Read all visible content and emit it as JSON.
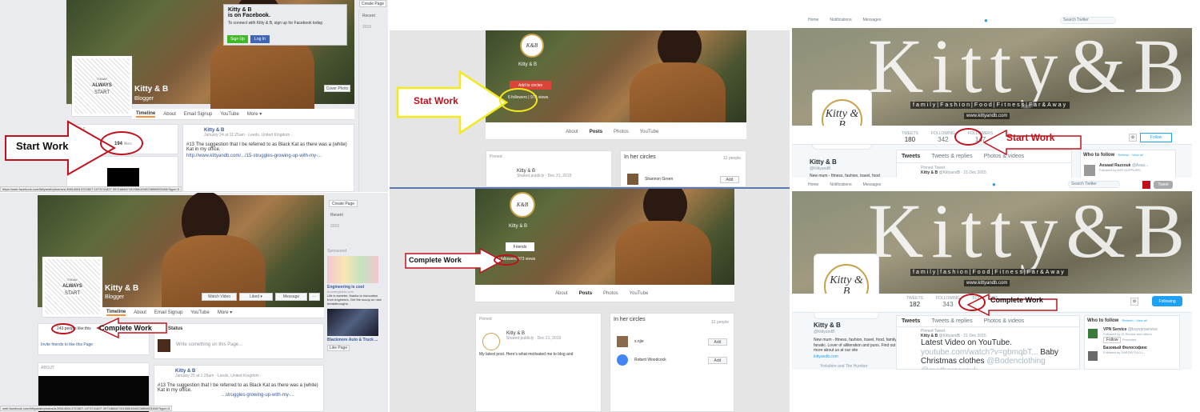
{
  "facebook_top": {
    "name": "Kitty & B",
    "category": "Blogger",
    "popup_title": "Kitty & B",
    "popup_sub": "is on Facebook.",
    "popup_text": "To connect with Kitty & B, sign up for Facebook today.",
    "signup": "Sign Up",
    "login": "Log In",
    "cover_photo": "Cover Photo",
    "create_page": "Create Page",
    "recent": "Recent",
    "year": "2015",
    "tabs": [
      "Timeline",
      "About",
      "Email Signup",
      "YouTube",
      "More ▾"
    ],
    "people": "PEOPLE",
    "likes_num": "194",
    "likes_label": "likes",
    "about": "ABOUT",
    "post_author": "Kitty & B",
    "post_meta": "January 24 at 11:25am · Leeds, United Kingdom ·",
    "post_text": "#13 The suggestion that I be referred to as Black Kat as there was a (white) Kat in my office.",
    "post_link": "http://www.kittyandb.com/.../15-struggles-growing-up-with-my-...",
    "annotation": "Start Work",
    "status_url": "https://web.facebook.com/kittyandb/photos/a.398140613722827.1073741827.397186667151555/404023859803168/?type=3",
    "logo_lines": [
      "TODAY",
      "ALWAYS",
      "START"
    ]
  },
  "facebook_bottom": {
    "name": "Kitty & B",
    "category": "Blogger",
    "watch_video": "Watch Video",
    "liked": "Liked ▾",
    "message": "Message",
    "more": "···",
    "create_page": "Create Page",
    "recent": "Recent",
    "year": "2015",
    "tabs": [
      "Timeline",
      "About",
      "Email Signup",
      "YouTube",
      "More ▾"
    ],
    "likes_text": "243 people like this",
    "invite": "Invite friends to like this Page",
    "status": "Status",
    "write": "Write something on this Page...",
    "about": "ABOUT",
    "annotation": "Complete Work",
    "post_author": "Kitty & B",
    "post_meta": "January 25 at 1:25am · Leeds, United Kingdom ·",
    "post_text": "#13 The suggestion that I be referred to as Black Kat as there was a (white) Kat in my office.",
    "post_link": "...struggles-growing-up-with-my-...",
    "sponsored": "Sponsored",
    "ad1_title": "Engineering is cool",
    "ad1_url": "boonengineer.com",
    "ad1_text": "Life is sweeter, thanks to innovation from engineers. Get the scoop on new breakthroughs.",
    "ad2_title": "Blackmore Auto & Truck ...",
    "like_page": "Like Page",
    "status_url": "web.facebook.com/kittyandb/photos/a.398140613722827.1073741827.397186667151555/404023859803168/?type=3",
    "logo_lines": [
      "TODAY",
      "ALWAYS",
      "START"
    ]
  },
  "gplus_top": {
    "name": "Kitty & B",
    "add_circles": "Add to circles",
    "followers": "6 followers",
    "views": "973 views",
    "tabs": [
      "About",
      "Posts",
      "Photos",
      "YouTube"
    ],
    "pinned": "Pinned",
    "post_author": "Kitty & B",
    "post_meta": "Shared publicly · Dec 31, 2015",
    "circles": "In her circles",
    "circles_count": "12 people",
    "person1": "Shannon Green",
    "add": "Add",
    "annotation": "Stat Work"
  },
  "gplus_bottom": {
    "name": "Kitty & B",
    "friends": "Friends",
    "followers": "93 followers",
    "views": "973 views",
    "tabs": [
      "About",
      "Posts",
      "Photos",
      "YouTube"
    ],
    "pinned": "Pinned",
    "post_author": "Kitty & B",
    "post_meta": "Shared publicly · Dec 21, 2015",
    "post_text": "My latest post. Here's what motivated me to blog and",
    "circles": "In her circles",
    "circles_count": "12 people",
    "person1": "s.njie",
    "person2": "Robert Woodcock",
    "add": "Add",
    "annotation": "Complete Work"
  },
  "twitter_top": {
    "nav": [
      "Home",
      "Notifications",
      "Messages"
    ],
    "search": "Search Twitter",
    "banner_title": "Kitty&B",
    "tagline": "family|Fashion|Food|Fitness|Far&Away",
    "site": "www.kittyandb.com",
    "logo_text": "Kitty & B",
    "stats": [
      {
        "label": "TWEETS",
        "value": "180"
      },
      {
        "label": "FOLLOWING",
        "value": "342"
      },
      {
        "label": "FOLLOWERS",
        "value": "147"
      },
      {
        "label": "LIKES",
        "value": ""
      }
    ],
    "follow": "Follow",
    "name": "Kitty & B",
    "handle": "@KittyandB",
    "bio": "New mum - fitness, fashion, travel, food",
    "tabs": [
      "Tweets",
      "Tweets & replies",
      "Photos & videos"
    ],
    "pinned": "Pinned Tweet",
    "tweet_author": "Kitty & B",
    "tweet_meta": "@KittyandB · 21 Dec 2015",
    "who_to_follow": "Who to follow",
    "wtf_links": "· Refresh · View all",
    "wtf_name": "Assaad Razzouk",
    "wtf_handle": "@Assa...",
    "wtf_followed": "Followed by AVR SUPPLIER...",
    "annotation": "Start Work"
  },
  "twitter_bottom": {
    "nav": [
      "Home",
      "Notifications",
      "Messages"
    ],
    "search": "Search Twitter",
    "tweet_btn": "Tweet",
    "banner_title": "Kitty&B",
    "tagline": "family|fashion|Food|Fitness|Far&Away",
    "site": "www.kittyandb.com",
    "logo_text": "Kitty & B",
    "stats": [
      {
        "label": "TWEETS",
        "value": "182"
      },
      {
        "label": "FOLLOWING",
        "value": "343"
      },
      {
        "label": "FOLLOWERS",
        "value": "201"
      }
    ],
    "following": "Following",
    "name": "Kitty & B",
    "handle": "@KittyandB",
    "bio": "New mum - fitness, fashion, travel, food, family fanatic. Lover of alliteration and puns. Find out more about us at our site",
    "bio_link": "kittyandb.com",
    "location": "Yorkshire and The Humber",
    "tabs": [
      "Tweets",
      "Tweets & replies",
      "Photos & videos"
    ],
    "pinned": "Pinned Tweet",
    "tweet_author": "Kitty & B",
    "tweet_meta": "@KittyandB · 21 Dec 2015",
    "tweet_text": "Latest Video on YouTube.",
    "tweet_link": "youtube.com/watch?v=gbmqbT...",
    "tweet_text2": "Baby Christmas clothes",
    "tweet_mention": "@Bodenclothing @mothercareuk",
    "who_to_follow": "Who to follow",
    "wtf_links": "· Refresh · View all",
    "wtf1_name": "VPN Service",
    "wtf1_handle": "@buyvpnservice",
    "wtf1_followed": "Followed by ID Review and others",
    "wtf1_follow": "Follow",
    "wtf1_promoted": "Promoted",
    "wtf2_name": "Базовый Философию",
    "wtf2_followed": "Followed by SAROFFOLO L...",
    "annotation": "Complete Work"
  },
  "colors": {
    "fb_blue": "#4267b2",
    "annotation_red": "#c0121c",
    "gplus_red": "#db4437",
    "twitter_blue": "#1da1f2"
  }
}
